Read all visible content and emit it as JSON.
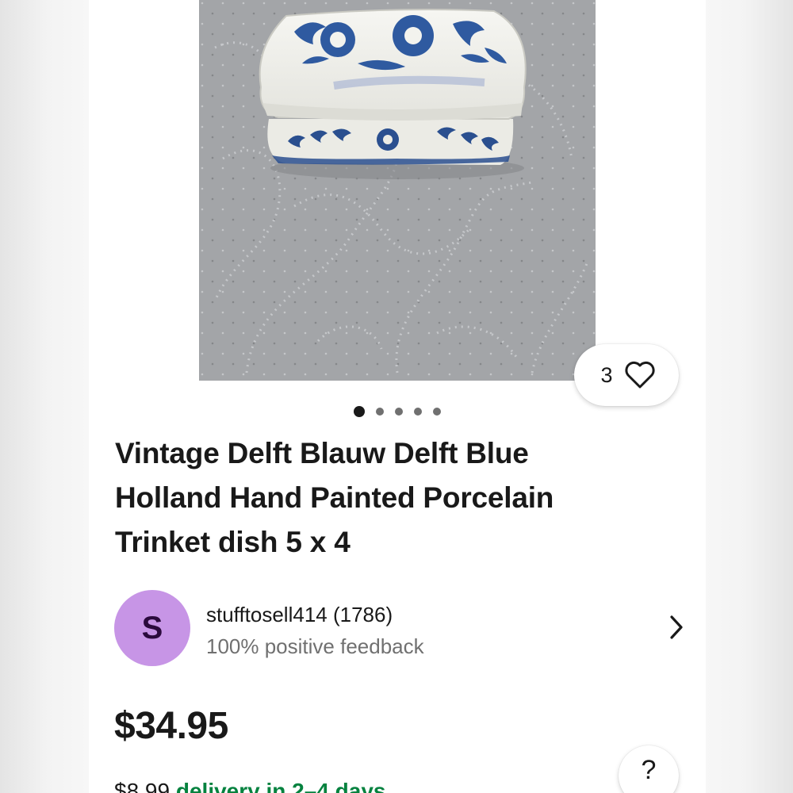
{
  "listing": {
    "title": "Vintage Delft Blauw Delft Blue Holland Hand Painted Porcelain Trinket dish 5 x 4",
    "watch_count": "3",
    "image_count": 5,
    "active_image": 1,
    "icons": [
      "heart-icon",
      "chevron-right-icon",
      "question-icon"
    ]
  },
  "seller": {
    "initial": "S",
    "name": "stufftosell414 (1786)",
    "feedback": "100% positive feedback"
  },
  "pricing": {
    "price": "$34.95",
    "shipping_cost": "$8.99",
    "delivery": "delivery in 2–4 days"
  },
  "help": {
    "label": "?"
  },
  "colors": {
    "brand_text": "#191919",
    "secondary_text": "#707070",
    "avatar_bg": "#c795e6",
    "delivery_green": "#05823f",
    "delft_blue": "#2a4f8f"
  }
}
